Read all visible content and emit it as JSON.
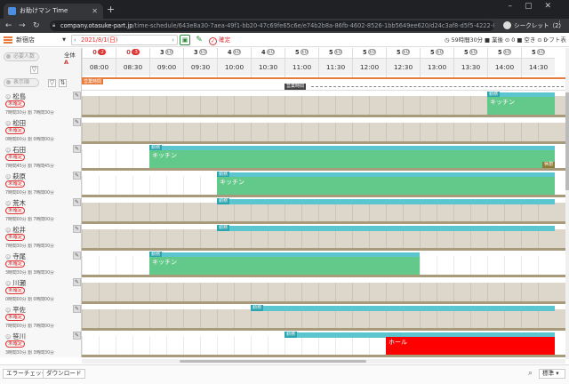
{
  "browser": {
    "tab_title": "お助けマン Time",
    "url_host": "company.otasuke-part.jp",
    "url_path": "/time-schedule/643e8a30-7aea-49f1-bb20-47c69fe65c6e/e74b2b8a-86fb-4602-8526-1bb5649ee620/d24c3af8-d5f5-4222-8da3-a0b2c90f1c3...",
    "incognito_label": "シークレット（2）"
  },
  "toolbar": {
    "store": "新宿店",
    "date": "2021/8/1(日)",
    "save_icon": "▣",
    "edit_icon": "✎",
    "confirm_label": "確定",
    "work_total": "59時間30分",
    "counts_label": "■ 業後 ⊙ 0 ■ 空き ⊙ 0",
    "shift_label": "シフト表"
  },
  "gridhead": {
    "filter_placeholder_1": "必要人数",
    "filter_placeholder_2": "表示順",
    "all_label": "全体",
    "all_count": "A",
    "times": [
      {
        "count": "0",
        "badge": "-2",
        "warn": true,
        "time": "08:00"
      },
      {
        "count": "0",
        "badge": "-3",
        "warn": true,
        "time": "08:30"
      },
      {
        "count": "3",
        "badge": "±0",
        "warn": false,
        "time": "09:00"
      },
      {
        "count": "3",
        "badge": "±0",
        "warn": false,
        "time": "09:30"
      },
      {
        "count": "4",
        "badge": "±0",
        "warn": false,
        "time": "10:00"
      },
      {
        "count": "4",
        "badge": "±0",
        "warn": false,
        "time": "10:30"
      },
      {
        "count": "5",
        "badge": "±0",
        "warn": false,
        "time": "11:00"
      },
      {
        "count": "5",
        "badge": "±0",
        "warn": false,
        "time": "11:30"
      },
      {
        "count": "5",
        "badge": "±0",
        "warn": false,
        "time": "12:00"
      },
      {
        "count": "5",
        "badge": "±0",
        "warn": false,
        "time": "12:30"
      },
      {
        "count": "5",
        "badge": "±0",
        "warn": false,
        "time": "13:00"
      },
      {
        "count": "5",
        "badge": "±0",
        "warn": false,
        "time": "13:30"
      },
      {
        "count": "5",
        "badge": "±0",
        "warn": false,
        "time": "14:00"
      },
      {
        "count": "5",
        "badge": "±0",
        "warn": false,
        "time": "14:30"
      }
    ],
    "biz_label": "営業時間",
    "open_label": "営業時間"
  },
  "rows": [
    {
      "name": "松島",
      "status": "未確定",
      "stats": "7時間30分 割 7時間30分",
      "bg": "beige",
      "work_label": "勤務",
      "work_from": 14.0,
      "work_to": 14.5,
      "block_label": "キッチン",
      "block_from": 14.0,
      "block_to": 14.5,
      "block_color": "green",
      "break_label": ""
    },
    {
      "name": "松田",
      "status": "未確定",
      "stats": "0時間00分 割 0時間00分",
      "bg": "beige",
      "work_label": "",
      "block_label": "",
      "break_label": ""
    },
    {
      "name": "石田",
      "status": "未確定",
      "stats": "7時間45分 割 7時間45分",
      "bg": "white",
      "work_label": "勤務",
      "work_from": 9.0,
      "work_to": 14.5,
      "block_label": "キッチン",
      "block_from": 9.0,
      "block_to": 14.5,
      "block_color": "green",
      "break_label": "休憩"
    },
    {
      "name": "萩原",
      "status": "未確定",
      "stats": "7時間00分 割 7時間00分",
      "bg": "white",
      "work_label": "勤務",
      "work_from": 10.0,
      "work_to": 14.5,
      "block_label": "キッチン",
      "block_from": 10.0,
      "block_to": 14.5,
      "block_color": "green",
      "break_label": ""
    },
    {
      "name": "荒木",
      "status": "未確定",
      "stats": "7時間00分 割 7時間00分",
      "bg": "beige",
      "work_label": "勤務",
      "work_from": 10.0,
      "work_to": 14.5,
      "block_label": "",
      "break_label": ""
    },
    {
      "name": "松井",
      "status": "未確定",
      "stats": "7時間30分 割 7時間30分",
      "bg": "beige",
      "work_label": "勤務",
      "work_from": 10.0,
      "work_to": 14.5,
      "block_label": "",
      "break_label": ""
    },
    {
      "name": "寺尾",
      "status": "未確定",
      "stats": "3時間30分 割 3時間30分",
      "bg": "white",
      "work_label": "勤務",
      "work_from": 9.0,
      "work_to": 12.5,
      "block_label": "キッチン",
      "block_from": 9.0,
      "block_to": 12.5,
      "block_color": "green",
      "break_label": ""
    },
    {
      "name": "川瀬",
      "status": "未確定",
      "stats": "0時間00分 割 0時間00分",
      "bg": "beige",
      "work_label": "",
      "block_label": "",
      "break_label": ""
    },
    {
      "name": "平佐",
      "status": "未確定",
      "stats": "7時間00分 割 7時間00分",
      "bg": "beige",
      "work_label": "勤務",
      "work_from": 10.5,
      "work_to": 14.5,
      "block_label": "",
      "break_label": ""
    },
    {
      "name": "笹川",
      "status": "未確定",
      "stats": "3時間30分 割 3時間30分",
      "bg": "white",
      "work_label": "勤務",
      "work_from": 11.0,
      "work_to": 14.5,
      "block_label": "ホール",
      "block_from": 12.5,
      "block_to": 14.5,
      "block_color": "red",
      "break_label": ""
    }
  ],
  "statusbar": {
    "error_check": "エラーチェック",
    "download": "ダウンロード",
    "zoom": "標準"
  }
}
